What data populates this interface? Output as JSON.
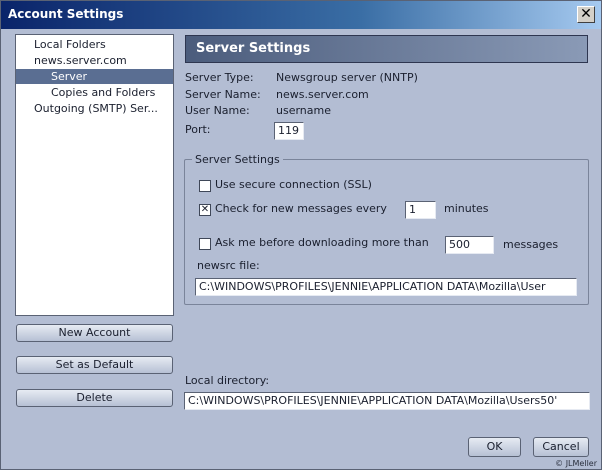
{
  "window": {
    "title": "Account Settings",
    "close_glyph": "✕"
  },
  "tree": {
    "items": [
      {
        "label": "Local Folders"
      },
      {
        "label": "news.server.com"
      },
      {
        "label": "Server"
      },
      {
        "label": "Copies and Folders"
      },
      {
        "label": "Outgoing (SMTP) Ser..."
      }
    ],
    "selected_index": 2
  },
  "buttons": {
    "new_account": "New Account",
    "set_default": "Set as Default",
    "delete": "Delete",
    "ok": "OK",
    "cancel": "Cancel"
  },
  "panel": {
    "header": "Server Settings",
    "server_type_label": "Server Type:",
    "server_type_value": "Newsgroup server (NNTP)",
    "server_name_label": "Server Name:",
    "server_name_value": "news.server.com",
    "user_name_label": "User Name:",
    "user_name_value": "username",
    "port_label": "Port:",
    "port_value": "119"
  },
  "group": {
    "legend": "Server Settings",
    "ssl_label": "Use secure connection (SSL)",
    "ssl_checked": false,
    "check_label": "Check for new messages every",
    "check_checked": true,
    "check_glyph": "✕",
    "check_value": "1",
    "check_unit": "minutes",
    "ask_label": "Ask me before downloading more than",
    "ask_checked": false,
    "ask_value": "500",
    "ask_unit": "messages",
    "newsrc_label": "newsrc file:",
    "newsrc_value": "C:\\WINDOWS\\PROFILES\\JENNIE\\APPLICATION DATA\\Mozilla\\User"
  },
  "local": {
    "label": "Local directory:",
    "value": "C:\\WINDOWS\\PROFILES\\JENNIE\\APPLICATION DATA\\Mozilla\\Users50'"
  },
  "footer": {
    "credit": "© JLMeller"
  },
  "colors": {
    "title_start": "#0a246a",
    "title_end": "#a6caf0",
    "selection": "#5a6e92",
    "background": "#b3bdd3"
  }
}
